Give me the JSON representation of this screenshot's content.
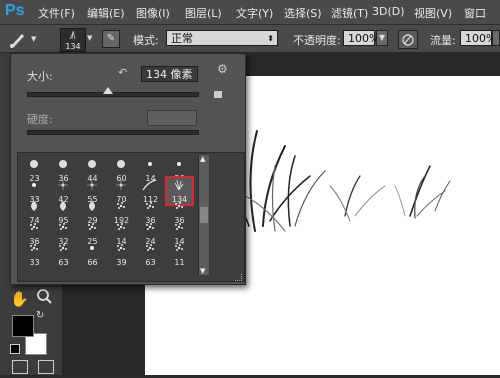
{
  "app": {
    "logo": "Ps"
  },
  "menu": [
    "文件(F)",
    "编辑(E)",
    "图像(I)",
    "图层(L)",
    "文字(Y)",
    "选择(S)",
    "滤镜(T)",
    "3D(D)",
    "视图(V)",
    "窗口"
  ],
  "options": {
    "brush_size": "134",
    "mode_label": "模式:",
    "mode_value": "正常",
    "opacity_label": "不透明度:",
    "opacity_value": "100%",
    "flow_label": "流量:",
    "flow_value": "100%"
  },
  "brush_panel": {
    "size_label": "大小:",
    "size_value": "134 像素",
    "hardness_label": "硬度:",
    "size_slider_level": 0.47,
    "brushes": [
      {
        "label": "23",
        "shape": "blob"
      },
      {
        "label": "36",
        "shape": "blob"
      },
      {
        "label": "44",
        "shape": "blob"
      },
      {
        "label": "60",
        "shape": "blob"
      },
      {
        "label": "14",
        "shape": "dot"
      },
      {
        "label": "26",
        "shape": "dot"
      },
      {
        "label": "33",
        "shape": "dot"
      },
      {
        "label": "42",
        "shape": "star"
      },
      {
        "label": "55",
        "shape": "star"
      },
      {
        "label": "70",
        "shape": "star"
      },
      {
        "label": "112",
        "shape": "stroke"
      },
      {
        "label": "134",
        "shape": "grass"
      },
      {
        "label": "74",
        "shape": "leaf"
      },
      {
        "label": "95",
        "shape": "leaf"
      },
      {
        "label": "29",
        "shape": "leaf"
      },
      {
        "label": "192",
        "shape": "speckle"
      },
      {
        "label": "36",
        "shape": "speckle"
      },
      {
        "label": "36",
        "shape": "speckle"
      },
      {
        "label": "36",
        "shape": "speckle"
      },
      {
        "label": "32",
        "shape": "speckle"
      },
      {
        "label": "25",
        "shape": "speckle"
      },
      {
        "label": "14",
        "shape": "speckle"
      },
      {
        "label": "24",
        "shape": "speckle"
      },
      {
        "label": "14",
        "shape": "speckle"
      },
      {
        "label": "33",
        "shape": "speckle"
      },
      {
        "label": "63",
        "shape": "speckle"
      },
      {
        "label": "66",
        "shape": "dot"
      },
      {
        "label": "39",
        "shape": "speckle"
      },
      {
        "label": "63",
        "shape": "speckle"
      },
      {
        "label": "11",
        "shape": "speckle"
      }
    ],
    "selected_index": 11,
    "accent_color": "#e0262e"
  },
  "colors": {
    "foreground": "#000000",
    "background": "#ffffff"
  }
}
